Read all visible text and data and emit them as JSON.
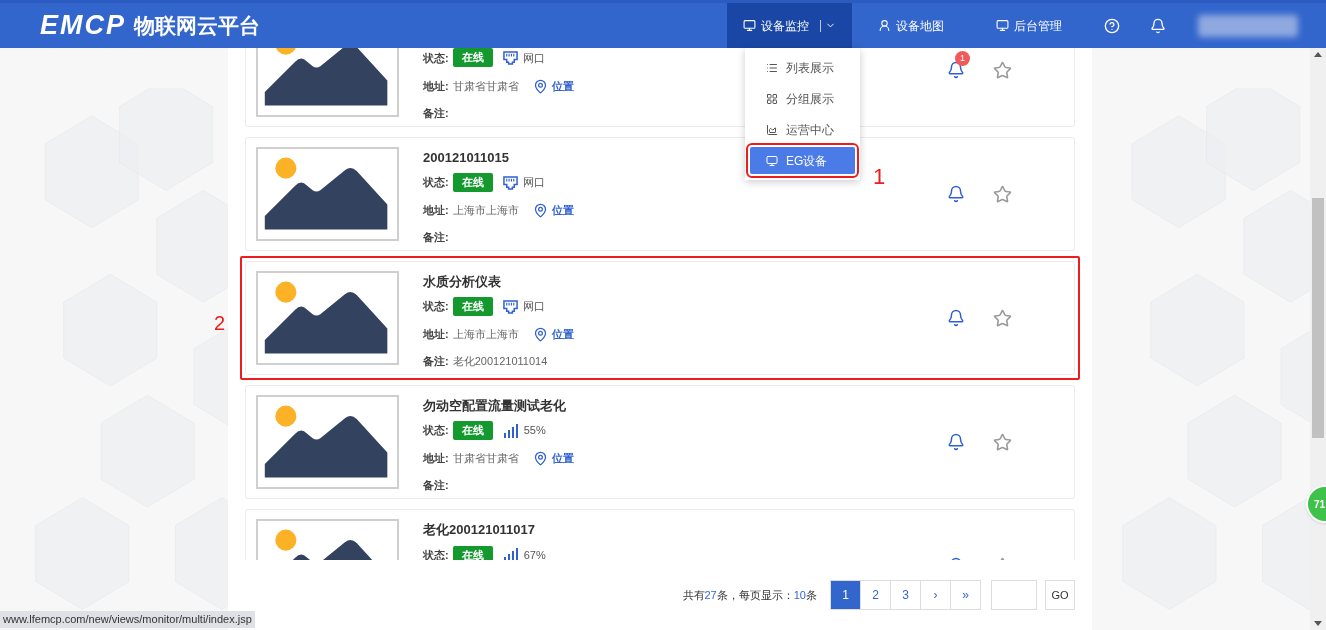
{
  "header": {
    "logo": "EMCP",
    "title": "物联网云平台",
    "nav": [
      {
        "kind": "monitor",
        "label": "设备监控",
        "selected": true,
        "dropdown": true
      },
      {
        "kind": "map",
        "label": "设备地图",
        "selected": false,
        "dropdown": false
      },
      {
        "kind": "admin",
        "label": "后台管理",
        "selected": false,
        "dropdown": false
      }
    ]
  },
  "dropdown_menu": [
    {
      "kind": "list",
      "label": "列表展示",
      "selected": false,
      "annotated": false
    },
    {
      "kind": "group",
      "label": "分组展示",
      "selected": false,
      "annotated": false
    },
    {
      "kind": "chart",
      "label": "运营中心",
      "selected": false,
      "annotated": false
    },
    {
      "kind": "monitor",
      "label": "EG设备",
      "selected": true,
      "annotated": true
    }
  ],
  "annotations": [
    "1",
    "2"
  ],
  "devices": [
    {
      "status_label": "状态:",
      "status": "在线",
      "connection": {
        "kind": "ethernet",
        "text": "网口"
      },
      "address_label": "地址:",
      "address": "甘肃省甘肃省",
      "location": "位置",
      "remark_label": "备注:",
      "alarm_count": "1",
      "annotated": false
    },
    {
      "name": "200121011015",
      "status_label": "状态:",
      "status": "在线",
      "connection": {
        "kind": "ethernet",
        "text": "网口"
      },
      "address_label": "地址:",
      "address": "上海市上海市",
      "location": "位置",
      "remark_label": "备注:",
      "annotated": false
    },
    {
      "name": "水质分析仪表",
      "status_label": "状态:",
      "status": "在线",
      "connection": {
        "kind": "ethernet",
        "text": "网口"
      },
      "address_label": "地址:",
      "address": "上海市上海市",
      "location": "位置",
      "remark_label": "备注:",
      "remark": "老化200121011014",
      "annotated": true
    },
    {
      "name": "勿动空配置流量测试老化",
      "status_label": "状态:",
      "status": "在线",
      "connection": {
        "kind": "signal",
        "text": "55%"
      },
      "address_label": "地址:",
      "address": "甘肃省甘肃省",
      "location": "位置",
      "remark_label": "备注:",
      "annotated": false
    },
    {
      "name": "老化200121011017",
      "status_label": "状态:",
      "status": "在线",
      "connection": {
        "kind": "signal",
        "text": "67%"
      },
      "annotated": false
    }
  ],
  "pagination": {
    "prefix": "共有",
    "total": "27",
    "middle": "条，每页显示：",
    "per_page": "10",
    "suffix": "条",
    "pages": [
      {
        "label": "1",
        "selected": true
      },
      {
        "label": "2",
        "selected": false
      },
      {
        "label": "3",
        "selected": false
      },
      {
        "label": "›",
        "selected": false
      },
      {
        "label": "»",
        "selected": false
      }
    ],
    "go": "GO"
  },
  "status_url": "www.lfemcp.com/new/views/monitor/multi/index.jsp",
  "floating_badge": "71"
}
